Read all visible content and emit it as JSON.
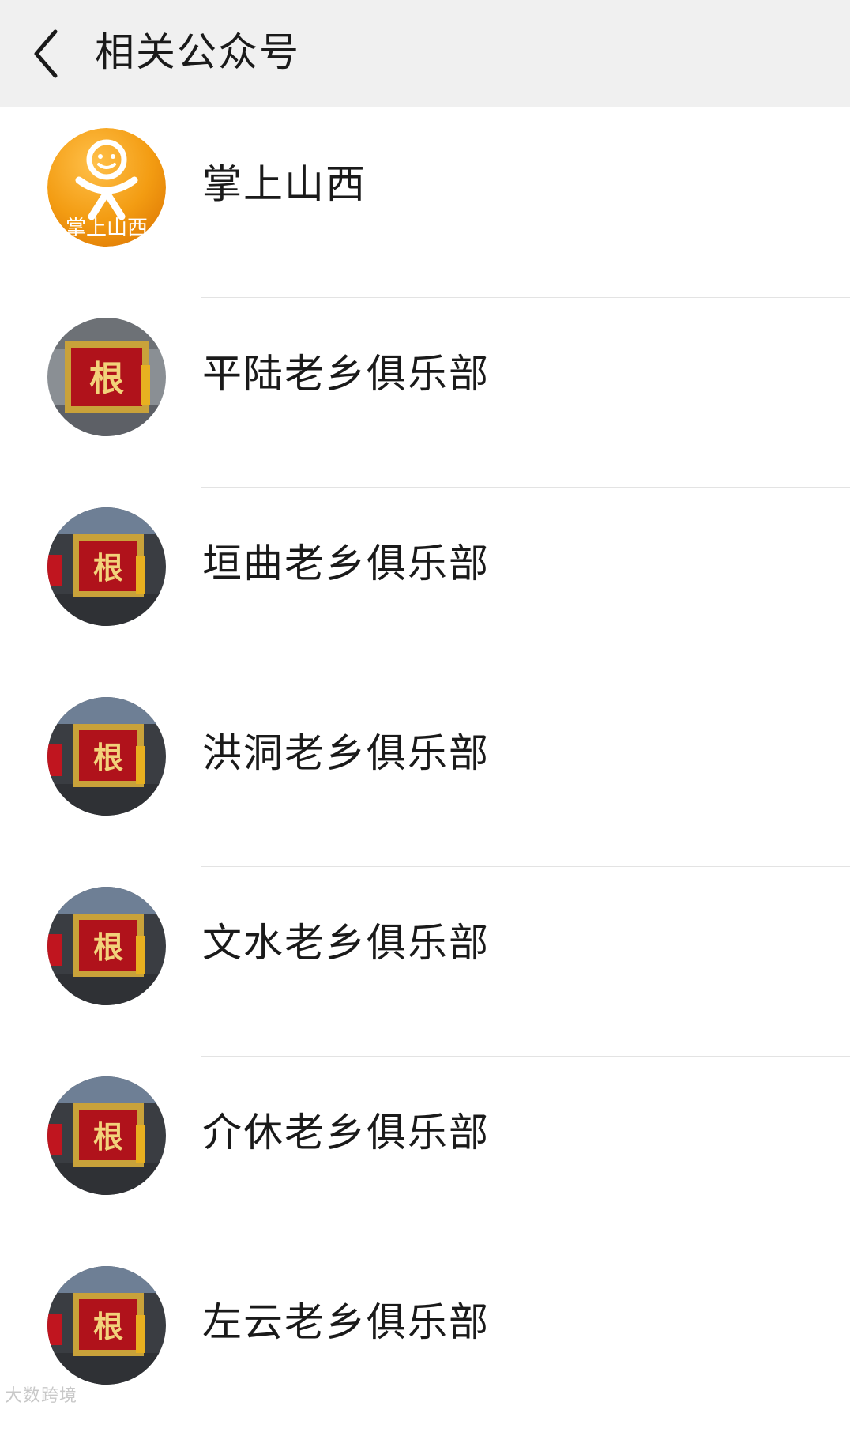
{
  "header": {
    "back_icon": "chevron-left-icon",
    "title": "相关公众号"
  },
  "accounts": [
    {
      "name": "掌上山西",
      "avatar": {
        "type": "logo",
        "text": "掌上山西",
        "color": "#f39c12"
      }
    },
    {
      "name": "平陆老乡俱乐部",
      "avatar": {
        "type": "plaque",
        "text": "根",
        "color": "#b0121b"
      }
    },
    {
      "name": "垣曲老乡俱乐部",
      "avatar": {
        "type": "plaque",
        "text": "根",
        "color": "#b0121b"
      }
    },
    {
      "name": "洪洞老乡俱乐部",
      "avatar": {
        "type": "plaque",
        "text": "根",
        "color": "#b0121b"
      }
    },
    {
      "name": "文水老乡俱乐部",
      "avatar": {
        "type": "plaque",
        "text": "根",
        "color": "#b0121b"
      }
    },
    {
      "name": "介休老乡俱乐部",
      "avatar": {
        "type": "plaque",
        "text": "根",
        "color": "#b0121b"
      }
    },
    {
      "name": "左云老乡俱乐部",
      "avatar": {
        "type": "plaque",
        "text": "根",
        "color": "#b0121b"
      }
    }
  ],
  "watermark": "大数跨境"
}
